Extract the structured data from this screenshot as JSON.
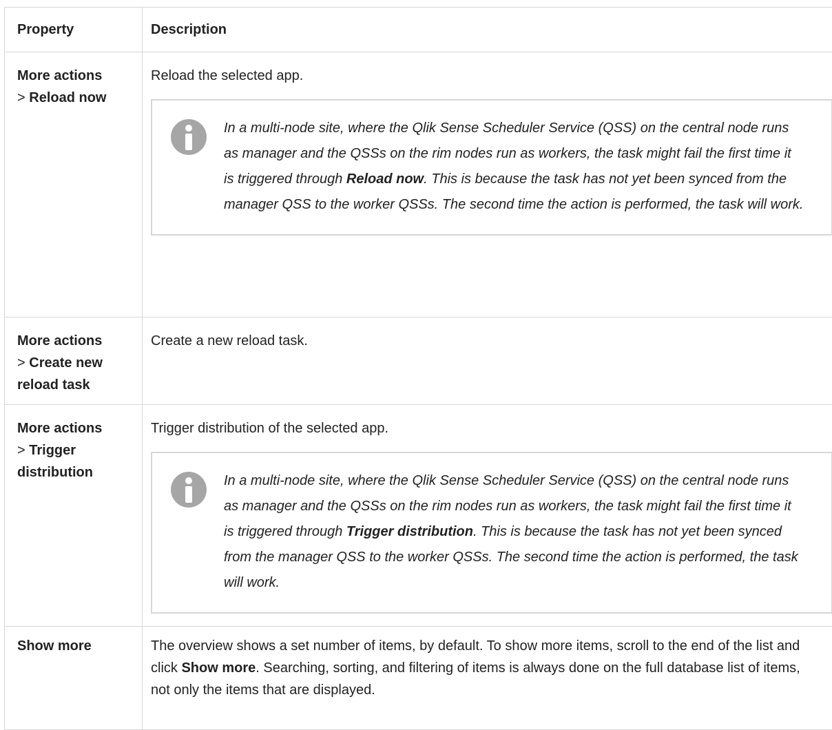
{
  "table": {
    "header": {
      "property": "Property",
      "description": "Description"
    },
    "rows": [
      {
        "prop_prefix": "More actions",
        "prop_sep": ">",
        "prop_item": "Reload now",
        "description": "Reload the selected app.",
        "note": {
          "before": "In a multi-node site, where the Qlik Sense Scheduler Service (QSS) on the central node runs as manager and the QSSs on the rim nodes run as workers, the task might fail the first time it is triggered through ",
          "bold": "Reload now",
          "after": ". This is because the task has not yet been synced from the manager QSS to the worker QSSs. The second time the action is performed, the task will work."
        }
      },
      {
        "prop_prefix": "More actions",
        "prop_sep": ">",
        "prop_item": "Create new reload task",
        "description": "Create a new reload task."
      },
      {
        "prop_prefix": "More actions",
        "prop_sep": ">",
        "prop_item": "Trigger distribution",
        "description": "Trigger distribution of the selected app.",
        "note": {
          "before": "In a multi-node site, where the Qlik Sense Scheduler Service (QSS) on the central node runs as manager and the QSSs on the rim nodes run as workers, the task might fail the first time it is triggered through ",
          "bold": "Trigger distribution",
          "after": ". This is because the task has not yet been synced from the manager QSS to the worker QSSs. The second time the action is performed, the task will work."
        }
      },
      {
        "prop_item": "Show more",
        "description_before": "The overview shows a set number of items, by default. To show more items, scroll to the end of the list and click ",
        "description_bold": "Show more",
        "description_after": ". Searching, sorting, and filtering of items is always done on the full database list of items, not only the items that are displayed."
      }
    ]
  },
  "icons": {
    "note_icon": "info-icon",
    "note_icon_color": "#a6a6a6"
  }
}
